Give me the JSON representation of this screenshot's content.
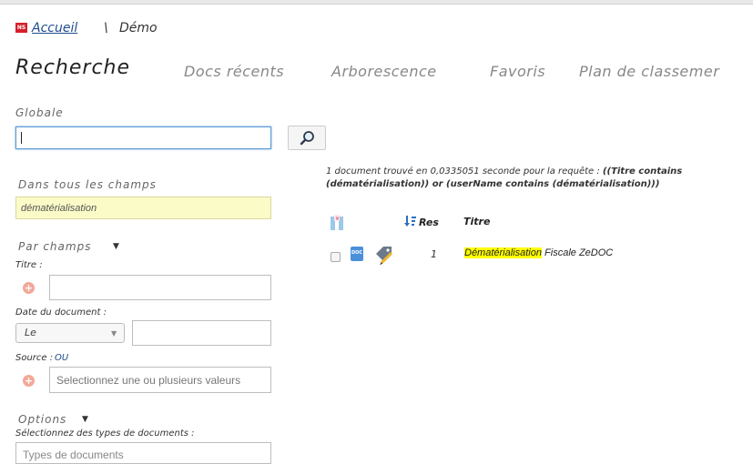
{
  "breadcrumb": {
    "logo_text": "NS",
    "home_label": "Accueil",
    "separator": "\\",
    "current": "Démo"
  },
  "tabs": [
    {
      "label": "Recherche",
      "active": true
    },
    {
      "label": "Docs récents"
    },
    {
      "label": "Arborescence"
    },
    {
      "label": "Favoris"
    },
    {
      "label": "Plan de classemer"
    }
  ],
  "search": {
    "global_label": "Globale",
    "global_value": "",
    "all_fields_label": "Dans tous les champs",
    "all_fields_value": "dématérialisation",
    "by_fields_label": "Par champs",
    "title_label": "Titre :",
    "title_value": "",
    "date_label": "Date du document :",
    "date_operator": "Le",
    "date_value": "",
    "source_label": "Source :",
    "source_mode": "OU",
    "source_placeholder": "Selectionnez une ou plusieurs valeurs",
    "options_label": "Options",
    "doc_types_label": "Sélectionnez des types de documents :",
    "doc_types_placeholder": "Types de documents"
  },
  "results": {
    "summary_prefix": "1 document trouvé en 0,0335051 seconde pour la requête : ",
    "query_line1": "((Titre contains",
    "query_line2": "(dématérialisation)) or (userName contains (dématérialisation)))",
    "col_res": "Res",
    "col_title": "Titre",
    "rows": [
      {
        "num": "1",
        "title_highlight": "Dématérialisation",
        "title_rest": " Fiscale ZeDOC",
        "doc_badge": "DOC"
      }
    ]
  },
  "colors": {
    "link": "#1f4e8c",
    "highlight": "#ffff00",
    "field_yellow": "#fbfbc8",
    "logo_red": "#d5202b"
  }
}
